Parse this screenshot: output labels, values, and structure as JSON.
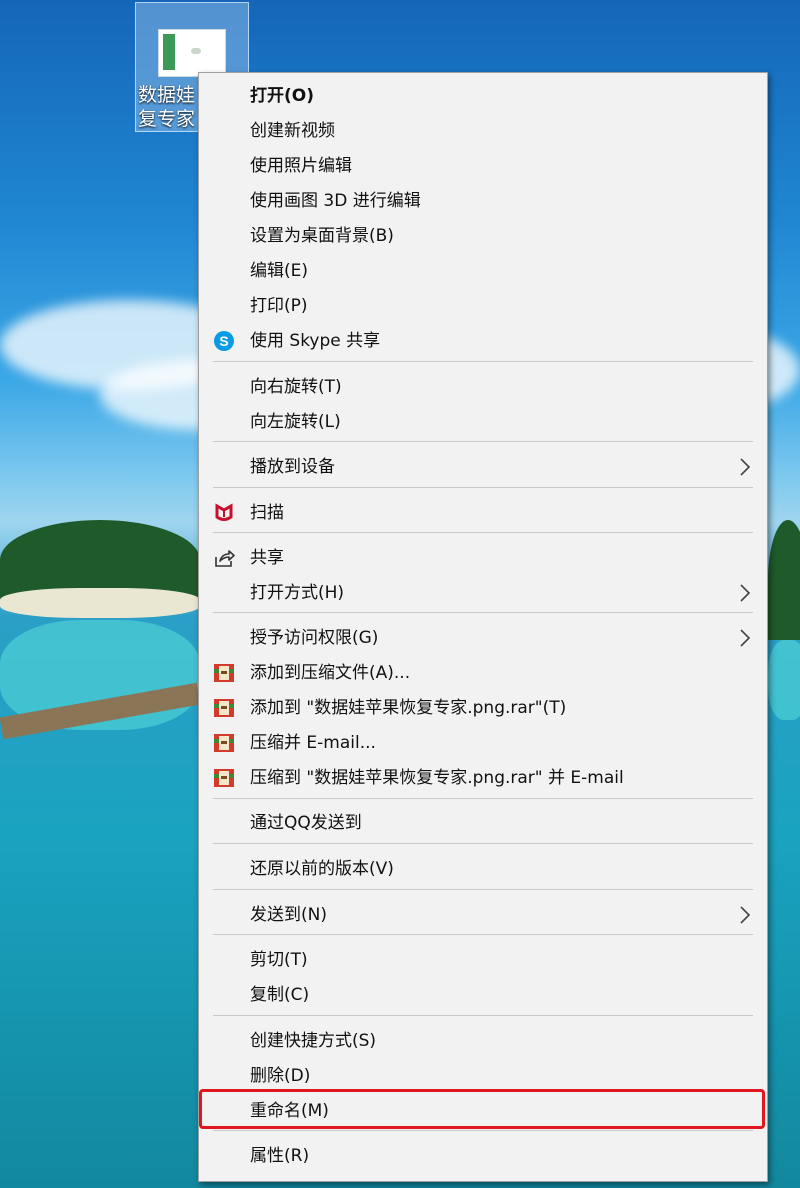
{
  "desktop": {
    "icon": {
      "label_line1": "数据娃",
      "label_line2": "复专家"
    }
  },
  "menu": {
    "items": [
      {
        "label": "打开(O)",
        "bold": true,
        "icon": ""
      },
      {
        "label": "创建新视频",
        "icon": ""
      },
      {
        "label": "使用照片编辑",
        "icon": ""
      },
      {
        "label": "使用画图 3D 进行编辑",
        "icon": ""
      },
      {
        "label": "设置为桌面背景(B)",
        "icon": ""
      },
      {
        "label": "编辑(E)",
        "icon": ""
      },
      {
        "label": "打印(P)",
        "icon": ""
      },
      {
        "label": "使用 Skype 共享",
        "icon": "skype-icon"
      },
      {
        "label": "向右旋转(T)",
        "icon": ""
      },
      {
        "label": "向左旋转(L)",
        "icon": ""
      },
      {
        "label": "播放到设备",
        "icon": "",
        "submenu": true
      },
      {
        "label": "扫描",
        "icon": "mcafee-icon"
      },
      {
        "label": "共享",
        "icon": "share-icon"
      },
      {
        "label": "打开方式(H)",
        "icon": "",
        "submenu": true
      },
      {
        "label": "授予访问权限(G)",
        "icon": "",
        "submenu": true
      },
      {
        "label": "添加到压缩文件(A)...",
        "icon": "winrar-icon"
      },
      {
        "label": "添加到 \"数据娃苹果恢复专家.png.rar\"(T)",
        "icon": "winrar-icon"
      },
      {
        "label": "压缩并 E-mail...",
        "icon": "winrar-icon"
      },
      {
        "label": "压缩到 \"数据娃苹果恢复专家.png.rar\" 并 E-mail",
        "icon": "winrar-icon"
      },
      {
        "label": "通过QQ发送到",
        "icon": ""
      },
      {
        "label": "还原以前的版本(V)",
        "icon": ""
      },
      {
        "label": "发送到(N)",
        "icon": "",
        "submenu": true
      },
      {
        "label": "剪切(T)",
        "icon": ""
      },
      {
        "label": "复制(C)",
        "icon": ""
      },
      {
        "label": "创建快捷方式(S)",
        "icon": ""
      },
      {
        "label": "删除(D)",
        "icon": ""
      },
      {
        "label": "重命名(M)",
        "icon": "",
        "highlighted": true
      },
      {
        "label": "属性(R)",
        "icon": ""
      }
    ]
  },
  "colors": {
    "highlight_border": "#e0181e",
    "menu_background": "#f2f2f2",
    "skype": "#0a9be6",
    "mcafee": "#c8102e"
  }
}
